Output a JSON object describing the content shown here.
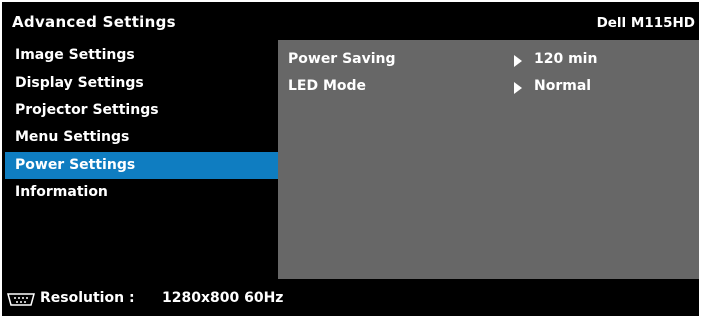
{
  "title": "Advanced Settings",
  "model": "Dell M115HD",
  "sidebar": {
    "items": [
      {
        "label": "Image Settings"
      },
      {
        "label": "Display Settings"
      },
      {
        "label": "Projector Settings"
      },
      {
        "label": "Menu Settings"
      },
      {
        "label": "Power Settings",
        "selected": true
      },
      {
        "label": "Information"
      }
    ]
  },
  "content": {
    "rows": [
      {
        "label": "Power Saving",
        "value": "120 min"
      },
      {
        "label": "LED Mode",
        "value": "Normal"
      }
    ]
  },
  "status": {
    "label": "Resolution :",
    "value": "1280x800 60Hz",
    "icon": "vga-connector-icon"
  },
  "colors": {
    "background": "#000000",
    "highlight": "#0f7dc1",
    "content_panel": "#676767",
    "text": "#ffffff"
  }
}
